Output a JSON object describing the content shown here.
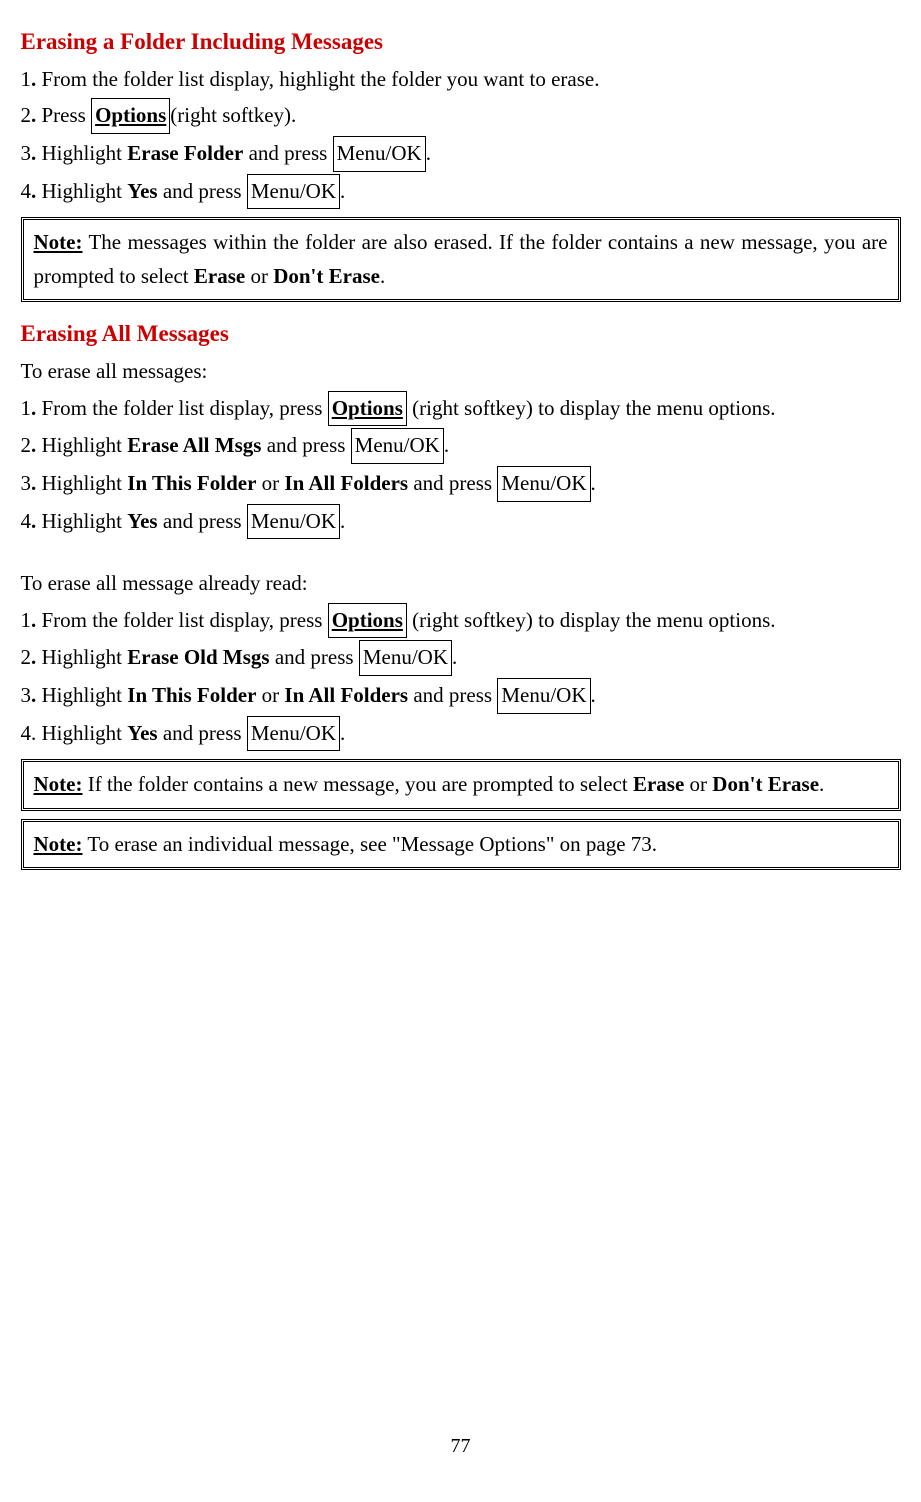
{
  "section1": {
    "title": "Erasing a Folder Including Messages",
    "steps": [
      {
        "num": "1",
        "pre": "From the folder list display, highlight the folder you want to erase."
      },
      {
        "num": "2",
        "pre": "Press ",
        "key1": "Options",
        "post1": "(right softkey)."
      },
      {
        "num": "3",
        "pre": "Highlight ",
        "bold1": "Erase Folder",
        "mid1": " and press ",
        "key1": "Menu/OK",
        "post1": "."
      },
      {
        "num": "4",
        "pre": "Highlight ",
        "bold1": "Yes",
        "mid1": " and press ",
        "key1": "Menu/OK",
        "post1": "."
      }
    ]
  },
  "note1": {
    "label": "Note:",
    "text1": " The messages within the folder are also erased. If the folder contains a new message, you are prompted to select ",
    "bold1": "Erase",
    "text2": " or ",
    "bold2": "Don't Erase",
    "text3": "."
  },
  "section2": {
    "title": "Erasing All Messages",
    "intro1": "To erase all messages:",
    "steps1": [
      {
        "num": "1",
        "pre": "From the folder list display, press ",
        "key1": "Options",
        "post1": " (right softkey) to display the menu options."
      },
      {
        "num": "2",
        "pre": "Highlight ",
        "bold1": "Erase All Msgs",
        "mid1": " and press ",
        "key1": "Menu/OK",
        "post1": "."
      },
      {
        "num": "3",
        "pre": "Highlight ",
        "bold1": "In This Folder",
        "mid1": " or ",
        "bold2": "In All Folders",
        "mid2": " and press ",
        "key1": "Menu/OK",
        "post1": "."
      },
      {
        "num": "4",
        "pre": "Highlight ",
        "bold1": "Yes",
        "mid1": " and press ",
        "key1": "Menu/OK",
        "post1": "."
      }
    ],
    "intro2": "To erase all message already read:",
    "steps2": [
      {
        "num": "1",
        "pre": "From the folder list display, press ",
        "key1": "Options",
        "post1": " (right softkey) to display the menu options."
      },
      {
        "num": "2",
        "pre": "Highlight ",
        "bold1": "Erase Old Msgs",
        "mid1": " and press ",
        "key1": "Menu/OK",
        "post1": "."
      },
      {
        "num": "3",
        "pre": "Highlight ",
        "bold1": "In This Folder",
        "mid1": " or ",
        "bold2": "In All Folders",
        "mid2": " and press ",
        "key1": "Menu/OK",
        "post1": "."
      },
      {
        "num": "4",
        "numplain": true,
        "pre": "Highlight ",
        "bold1": "Yes",
        "mid1": " and press ",
        "key1": "Menu/OK",
        "post1": "."
      }
    ]
  },
  "note2": {
    "label": "Note:",
    "text1": " If the folder contains a new message, you are prompted to select ",
    "bold1": "Erase",
    "text2": " or ",
    "bold2": "Don't Erase",
    "text3": "."
  },
  "note3": {
    "label": "Note:",
    "text1": " To erase an individual message, see \"Message Options\" on page 73."
  },
  "page_number": "77"
}
